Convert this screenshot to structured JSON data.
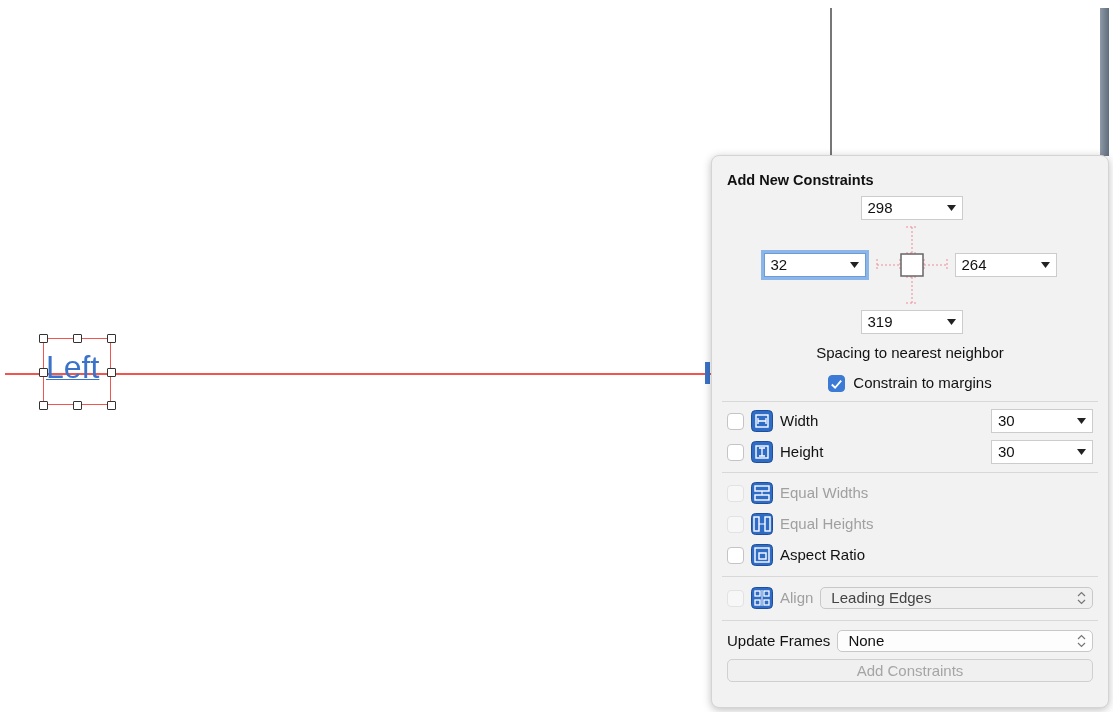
{
  "canvas": {
    "label": "Left"
  },
  "popover": {
    "title": "Add New Constraints",
    "spacing_fields": {
      "top": {
        "value": "298",
        "focused": false
      },
      "left": {
        "value": "32",
        "focused": true
      },
      "right": {
        "value": "264",
        "focused": false
      },
      "bottom": {
        "value": "319",
        "focused": false
      }
    },
    "spacing_label": "Spacing to nearest neighbor",
    "constrain_to_margins": {
      "label": "Constrain to margins",
      "checked": true
    },
    "size_rows": [
      {
        "kind": "width",
        "label": "Width",
        "checked": false,
        "value": "30"
      },
      {
        "kind": "height",
        "label": "Height",
        "checked": false,
        "value": "30"
      }
    ],
    "relation_rows": [
      {
        "kind": "equal-widths",
        "label": "Equal Widths",
        "checked": false,
        "disabled": true
      },
      {
        "kind": "equal-heights",
        "label": "Equal Heights",
        "checked": false,
        "disabled": true
      },
      {
        "kind": "aspect-ratio",
        "label": "Aspect Ratio",
        "checked": false,
        "disabled": false
      }
    ],
    "align": {
      "label": "Align",
      "checked": false,
      "disabled": true,
      "value": "Leading Edges"
    },
    "update_frames": {
      "label": "Update Frames",
      "value": "None"
    },
    "add_button": {
      "label": "Add Constraints",
      "disabled": true
    }
  }
}
